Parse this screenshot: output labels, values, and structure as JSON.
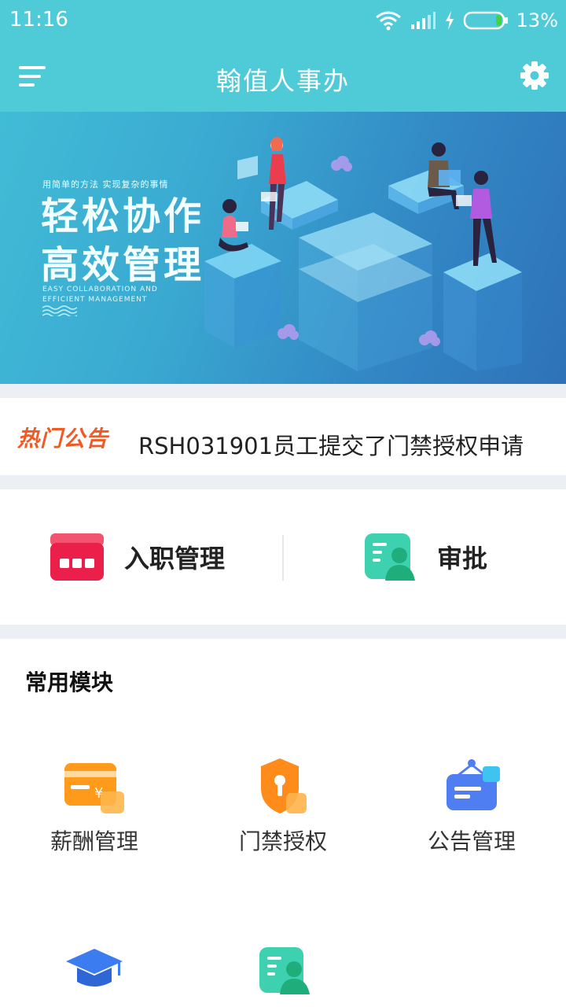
{
  "status_bar": {
    "time": "11:16",
    "battery": "13%"
  },
  "header": {
    "title": "翰值人事办"
  },
  "banner": {
    "tagline": "用简单的方法 实现复杂的事情",
    "slogan_line1": "轻松协作",
    "slogan_line2": "高效管理",
    "english": "EASY COLLABORATION AND EFFICIENT MANAGEMENT"
  },
  "notice": {
    "badge": "热门公告",
    "message": "RSH031901员工提交了门禁授权申请"
  },
  "quick_entries": [
    {
      "label": "入职管理",
      "icon": "onboarding-icon"
    },
    {
      "label": "审批",
      "icon": "approval-icon"
    }
  ],
  "modules": {
    "heading": "常用模块",
    "items": [
      {
        "label": "薪酬管理",
        "icon": "salary-card-icon"
      },
      {
        "label": "门禁授权",
        "icon": "access-shield-icon"
      },
      {
        "label": "公告管理",
        "icon": "notice-board-icon"
      },
      {
        "label": "",
        "icon": "graduation-cap-icon"
      },
      {
        "label": "",
        "icon": "approval-icon"
      }
    ]
  },
  "colors": {
    "primary": "#4fcbd8",
    "hot": "#f05a25",
    "divider": "#eceff4"
  }
}
